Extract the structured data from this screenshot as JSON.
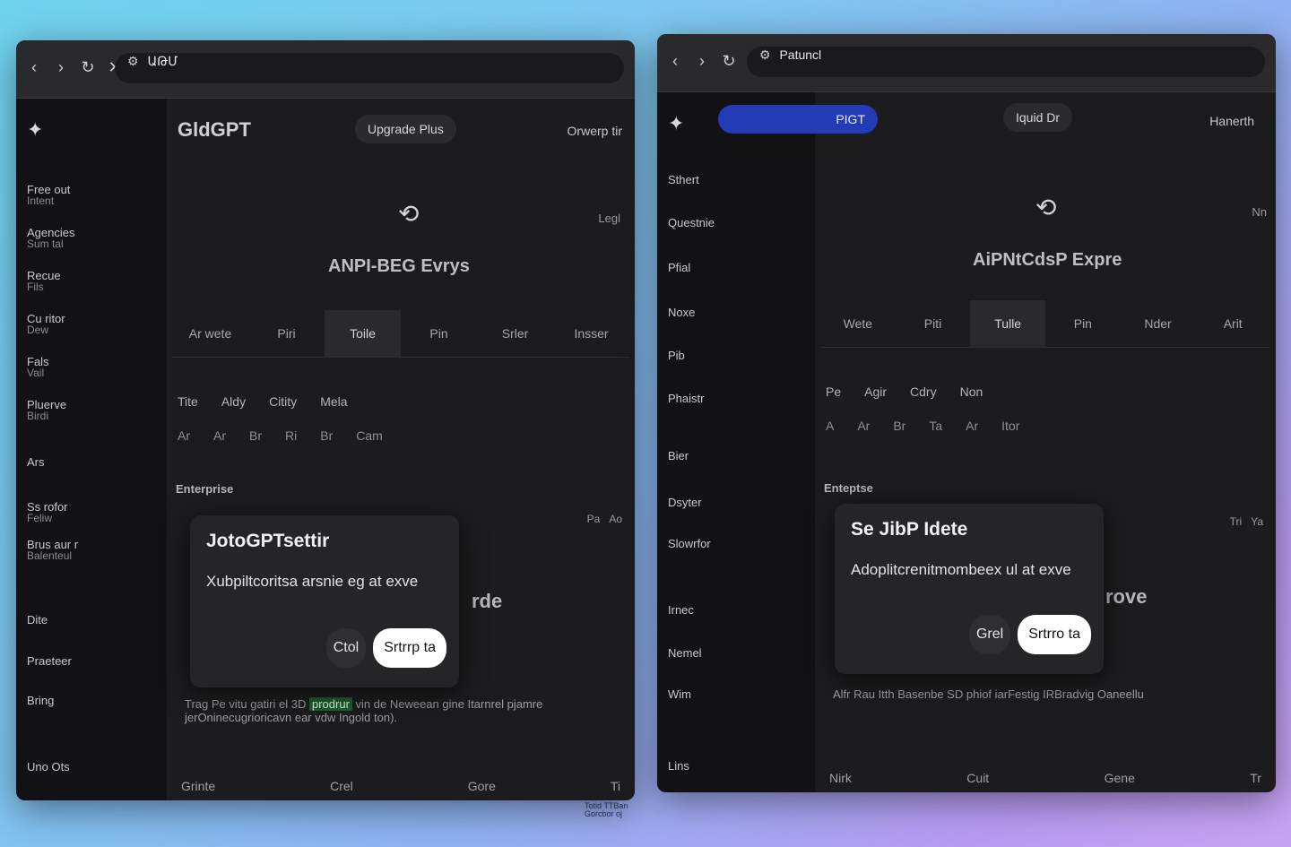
{
  "left": {
    "url_text": "ԱԹՄ",
    "nav_back": "‹",
    "nav_forward": "›",
    "nav_reload": "↻",
    "nav_close": "✕",
    "sidebar_items": [
      {
        "label": "Free out",
        "sub": "Intent"
      },
      {
        "label": "Agencies",
        "sub": "Sum tal"
      },
      {
        "label": "Recue",
        "sub": "Fils"
      },
      {
        "label": "Cu ritor",
        "sub": "Dew"
      },
      {
        "label": "Fals",
        "sub": "Vail"
      },
      {
        "label": "Pluerve",
        "sub": "Birdi"
      },
      {
        "label": "Ars",
        "sub": ""
      },
      {
        "label": "Ss rofor",
        "sub": "Feliw"
      },
      {
        "label": "Brus aur r",
        "sub": "Balenteul"
      },
      {
        "label": "Dite",
        "sub": ""
      },
      {
        "label": "Praeteer",
        "sub": ""
      },
      {
        "label": "Bring",
        "sub": ""
      },
      {
        "label": "Uno Ots",
        "sub": ""
      }
    ],
    "model_name": "GldGPT",
    "upgrade_pill": "Upgrade Plus",
    "user_link": "Orwerp tir",
    "hero_title": "ANPI-BEG Evrys",
    "side_hint": "Legl",
    "tabs": [
      "Ar wete",
      "Piri",
      "Toile",
      "Pin",
      "Srler",
      "Insser"
    ],
    "fields": [
      "Tite",
      "Aldy",
      "Citity",
      "Mela"
    ],
    "field_values": [
      "Ar",
      "Ar",
      "Br",
      "Ri",
      "Br",
      "Cam"
    ],
    "section_label": "Enterprise",
    "mini_buttons": [
      "Pa",
      "Ao"
    ],
    "bg_title": "rde",
    "desc_text": "Trag Pe vitu gatiri el 3D",
    "desc_highlight": "prodrur",
    "desc_rest": "vin de Neweean gine Itarnrel pjamre jerOninecugrioricavn ear vdw Ingold ton).",
    "bottom_items": [
      "Grinte",
      "Crel",
      "Gore",
      "Ti"
    ],
    "dialog": {
      "title": "JotoGPTsettir",
      "text": "Xubpiltcoritsa arsnie eg at exve",
      "cancel": "Ctol",
      "confirm": "Srtrrp ta"
    }
  },
  "right": {
    "url_text": "Patuncl",
    "nav_back": "‹",
    "nav_forward": "›",
    "nav_reload": "↻",
    "nav_close": "✕",
    "sidebar_items": [
      {
        "label": "Sthert",
        "sub": ""
      },
      {
        "label": "Questnie",
        "sub": ""
      },
      {
        "label": "Pfial",
        "sub": ""
      },
      {
        "label": "Noxe",
        "sub": ""
      },
      {
        "label": "Pib",
        "sub": ""
      },
      {
        "label": "Phaistr",
        "sub": ""
      },
      {
        "label": "Bier",
        "sub": ""
      },
      {
        "label": "Dsyter",
        "sub": ""
      },
      {
        "label": "Slowrfor",
        "sub": ""
      },
      {
        "label": "Irnec",
        "sub": ""
      },
      {
        "label": "Nemel",
        "sub": ""
      },
      {
        "label": "Wim",
        "sub": ""
      },
      {
        "label": "Lins",
        "sub": ""
      }
    ],
    "model_pill": "PIGT",
    "upgrade_pill": "Iquid Dr",
    "user_link": "Hanerth",
    "hero_title": "AiPNtCdsP Expre",
    "side_hint": "Nn",
    "tabs": [
      "Wete",
      "Piti",
      "Tulle",
      "Pin",
      "Nder",
      "Arit"
    ],
    "fields": [
      "Pe",
      "Agir",
      "Cdry",
      "Non"
    ],
    "field_values": [
      "A",
      "Ar",
      "Br",
      "Ta",
      "Ar",
      "Itor"
    ],
    "section_label": "Enteptse",
    "mini_buttons": [
      "Tri",
      "Ya"
    ],
    "bg_title": "rove",
    "desc_text": "Alfr Rau Itth Basenbe SD phiof iarFestig IRBradvig",
    "desc_rest": "Oaneellu",
    "bottom_items": [
      "Nirk",
      "Cuit",
      "Gene",
      "Tr"
    ],
    "dialog": {
      "title": "Se JibP Idete",
      "text": "Adoplitcrenitmombeex ul at exve",
      "cancel": "Grel",
      "confirm": "Srtrro ta"
    }
  },
  "caption": {
    "left_line1": "Totid TTBan",
    "left_line2": "Gorcbor oj"
  }
}
